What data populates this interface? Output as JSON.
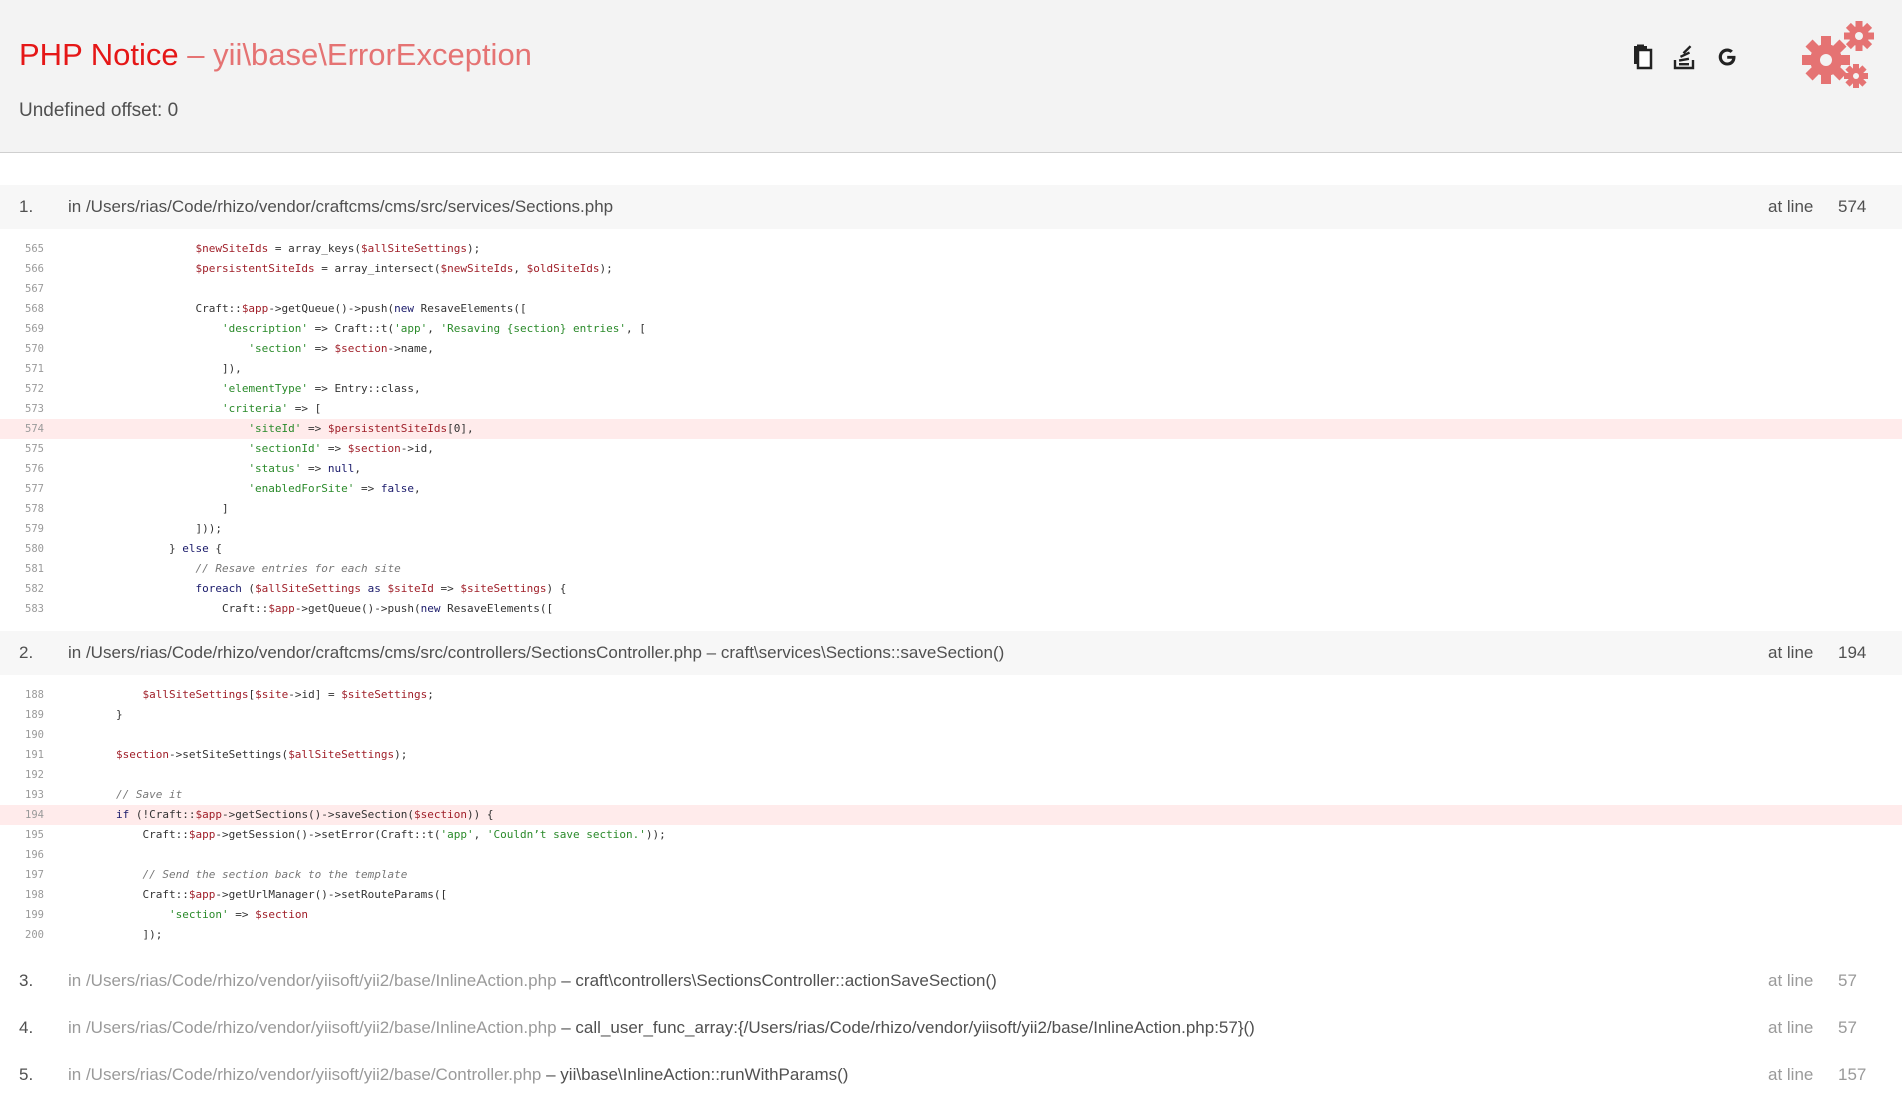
{
  "header": {
    "type": "PHP Notice",
    "separator": "–",
    "exception_class": "yii\\base\\ErrorException",
    "message": "Undefined offset: 0",
    "tools": [
      {
        "name": "copy-stacktrace",
        "icon": "clipboard-icon"
      },
      {
        "name": "search-stackoverflow",
        "icon": "stackoverflow-icon"
      },
      {
        "name": "search-google",
        "icon": "google-icon"
      }
    ],
    "logo_icon": "gears-icon",
    "accent_color": "#e57373"
  },
  "traces": [
    {
      "num": "1.",
      "file": "in /Users/rias/Code/rhizo/vendor/craftcms/cms/src/services/Sections.php",
      "call": "",
      "at_label": "at line",
      "line": "574",
      "lines": [
        {
          "n": "565",
          "code": "                    $newSiteIds = array_keys($allSiteSettings);"
        },
        {
          "n": "566",
          "code": "                    $persistentSiteIds = array_intersect($newSiteIds, $oldSiteIds);"
        },
        {
          "n": "567",
          "code": ""
        },
        {
          "n": "568",
          "code": "                    Craft::$app->getQueue()->push(new ResaveElements(["
        },
        {
          "n": "569",
          "code": "                        'description' => Craft::t('app', 'Resaving {section} entries', ["
        },
        {
          "n": "570",
          "code": "                            'section' => $section->name,"
        },
        {
          "n": "571",
          "code": "                        ]),"
        },
        {
          "n": "572",
          "code": "                        'elementType' => Entry::class,"
        },
        {
          "n": "573",
          "code": "                        'criteria' => ["
        },
        {
          "n": "574",
          "code": "                            'siteId' => $persistentSiteIds[0],",
          "hl": true
        },
        {
          "n": "575",
          "code": "                            'sectionId' => $section->id,"
        },
        {
          "n": "576",
          "code": "                            'status' => null,"
        },
        {
          "n": "577",
          "code": "                            'enabledForSite' => false,"
        },
        {
          "n": "578",
          "code": "                        ]"
        },
        {
          "n": "579",
          "code": "                    ]));"
        },
        {
          "n": "580",
          "code": "                } else {"
        },
        {
          "n": "581",
          "code": "                    // Resave entries for each site"
        },
        {
          "n": "582",
          "code": "                    foreach ($allSiteSettings as $siteId => $siteSettings) {"
        },
        {
          "n": "583",
          "code": "                        Craft::$app->getQueue()->push(new ResaveElements(["
        }
      ]
    },
    {
      "num": "2.",
      "file": "in /Users/rias/Code/rhizo/vendor/craftcms/cms/src/controllers/SectionsController.php",
      "call": " – craft\\services\\Sections::saveSection()",
      "at_label": "at line",
      "line": "194",
      "lines": [
        {
          "n": "188",
          "code": "            $allSiteSettings[$site->id] = $siteSettings;"
        },
        {
          "n": "189",
          "code": "        }"
        },
        {
          "n": "190",
          "code": ""
        },
        {
          "n": "191",
          "code": "        $section->setSiteSettings($allSiteSettings);"
        },
        {
          "n": "192",
          "code": ""
        },
        {
          "n": "193",
          "code": "        // Save it"
        },
        {
          "n": "194",
          "code": "        if (!Craft::$app->getSections()->saveSection($section)) {",
          "hl": true
        },
        {
          "n": "195",
          "code": "            Craft::$app->getSession()->setError(Craft::t('app', 'Couldn’t save section.'));"
        },
        {
          "n": "196",
          "code": ""
        },
        {
          "n": "197",
          "code": "            // Send the section back to the template"
        },
        {
          "n": "198",
          "code": "            Craft::$app->getUrlManager()->setRouteParams(["
        },
        {
          "n": "199",
          "code": "                'section' => $section"
        },
        {
          "n": "200",
          "code": "            ]);"
        }
      ]
    },
    {
      "num": "3.",
      "file": "in /Users/rias/Code/rhizo/vendor/yiisoft/yii2/base/InlineAction.php",
      "call": " – craft\\controllers\\SectionsController::actionSaveSection()",
      "at_label": "at line",
      "line": "57",
      "lines": []
    },
    {
      "num": "4.",
      "file": "in /Users/rias/Code/rhizo/vendor/yiisoft/yii2/base/InlineAction.php",
      "call": " – call_user_func_array:{/Users/rias/Code/rhizo/vendor/yiisoft/yii2/base/InlineAction.php:57}()",
      "at_label": "at line",
      "line": "57",
      "lines": []
    },
    {
      "num": "5.",
      "file": "in /Users/rias/Code/rhizo/vendor/yiisoft/yii2/base/Controller.php",
      "call": " – yii\\base\\InlineAction::runWithParams()",
      "at_label": "at line",
      "line": "157",
      "lines": []
    }
  ]
}
